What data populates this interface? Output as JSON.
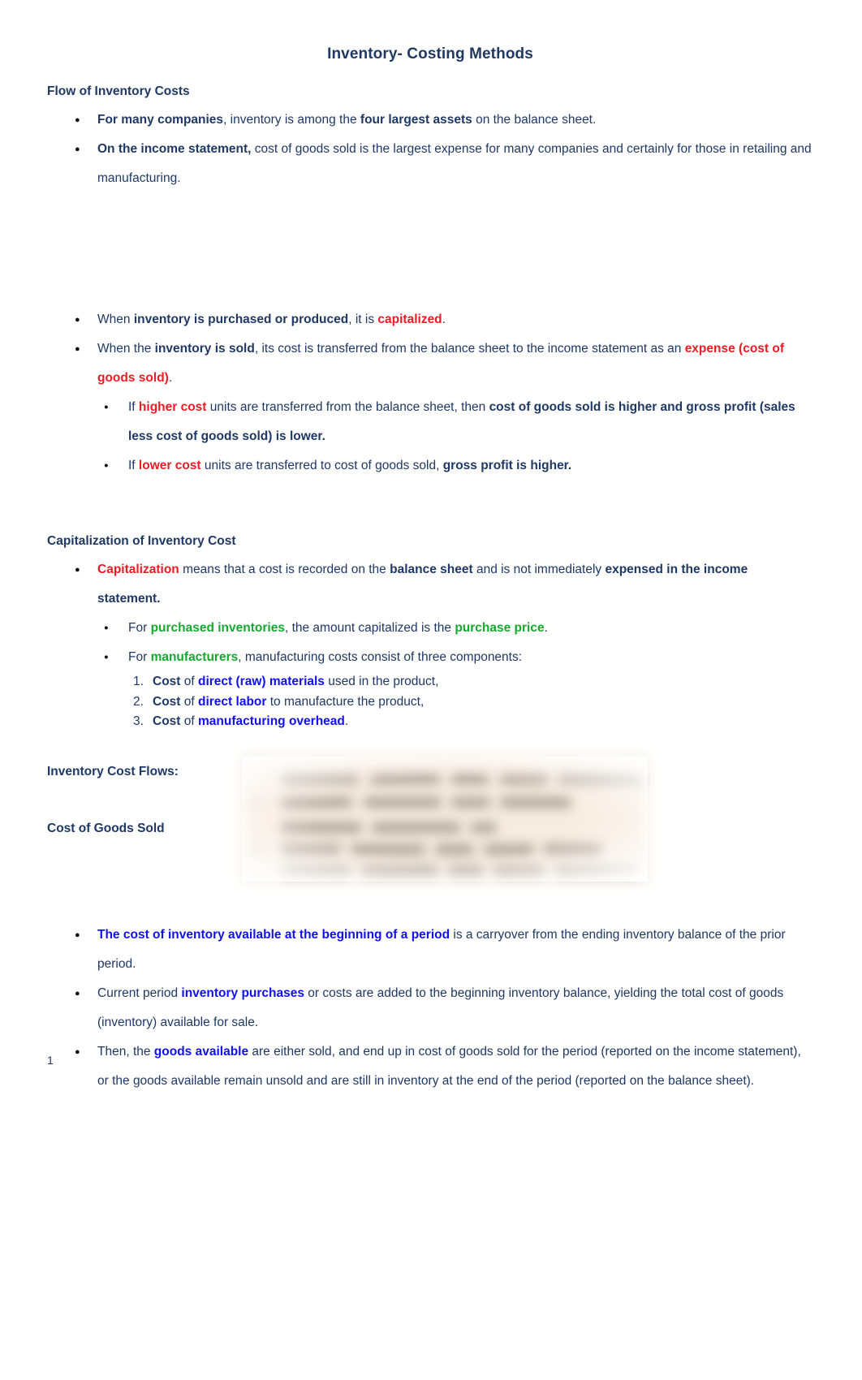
{
  "document": {
    "title": "Inventory- Costing Methods",
    "page_number": "1"
  },
  "sections": [
    {
      "heading": "Flow of Inventory Costs",
      "bullets": [
        {
          "runs": [
            {
              "t": "For many companies",
              "s": "bold-navy"
            },
            {
              "t": ", inventory is among the ",
              "s": "navy"
            },
            {
              "t": "four largest assets",
              "s": "bold-navy"
            },
            {
              "t": " on the balance sheet.",
              "s": "navy"
            }
          ]
        },
        {
          "runs": [
            {
              "t": "On the income statement,",
              "s": "bold-navy"
            },
            {
              "t": " cost of goods sold is the largest expense for many companies and certainly for those in retailing and manufacturing.",
              "s": "navy"
            }
          ]
        }
      ]
    }
  ],
  "flow_bullets": [
    {
      "runs": [
        {
          "t": "When ",
          "s": "navy"
        },
        {
          "t": "inventory is purchased or produced",
          "s": "bold-navy"
        },
        {
          "t": ", it is ",
          "s": "navy"
        },
        {
          "t": "capitalized",
          "s": "red"
        },
        {
          "t": ".",
          "s": "navy"
        }
      ]
    },
    {
      "runs": [
        {
          "t": "When the ",
          "s": "navy"
        },
        {
          "t": "inventory is sold",
          "s": "bold-navy"
        },
        {
          "t": ", its cost is transferred from the balance sheet to the income statement as an ",
          "s": "navy"
        },
        {
          "t": "expense (cost of goods sold)",
          "s": "red"
        },
        {
          "t": ".",
          "s": "navy"
        }
      ],
      "sub": [
        {
          "runs": [
            {
              "t": "If ",
              "s": "navy"
            },
            {
              "t": "higher cost",
              "s": "red"
            },
            {
              "t": " units are transferred from the balance sheet, then ",
              "s": "navy"
            },
            {
              "t": "cost of goods sold is higher and gross profit (sales less cost of goods sold) is lower.",
              "s": "bold-navy"
            }
          ]
        },
        {
          "runs": [
            {
              "t": "If ",
              "s": "navy"
            },
            {
              "t": "lower cost",
              "s": "red"
            },
            {
              "t": " units are transferred to cost of goods sold, ",
              "s": "navy"
            },
            {
              "t": "gross profit is higher.",
              "s": "bold-navy"
            }
          ]
        }
      ]
    }
  ],
  "capitalization": {
    "heading": "Capitalization of Inventory Cost",
    "bullet": {
      "runs": [
        {
          "t": "Capitalization",
          "s": "red"
        },
        {
          "t": " means that a cost is recorded on the ",
          "s": "navy"
        },
        {
          "t": "balance sheet",
          "s": "bold-navy"
        },
        {
          "t": " and is not immediately ",
          "s": "navy"
        },
        {
          "t": "expensed in the income statement.",
          "s": "bold-navy"
        }
      ]
    },
    "sub_bullets": [
      {
        "runs": [
          {
            "t": "For ",
            "s": "navy"
          },
          {
            "t": "purchased inventories",
            "s": "green"
          },
          {
            "t": ", the amount capitalized is the ",
            "s": "navy"
          },
          {
            "t": "purchase price",
            "s": "green"
          },
          {
            "t": ".",
            "s": "navy"
          }
        ]
      },
      {
        "runs": [
          {
            "t": "For ",
            "s": "navy"
          },
          {
            "t": "manufacturers",
            "s": "green"
          },
          {
            "t": ", manufacturing costs consist of three components:",
            "s": "navy"
          }
        ]
      }
    ],
    "numbered": [
      {
        "runs": [
          {
            "t": "Cost",
            "s": "bold-navy"
          },
          {
            "t": " of ",
            "s": "navy"
          },
          {
            "t": "direct (raw) materials",
            "s": "blue"
          },
          {
            "t": " used in the product,",
            "s": "navy"
          }
        ]
      },
      {
        "runs": [
          {
            "t": "Cost",
            "s": "bold-navy"
          },
          {
            "t": " of ",
            "s": "navy"
          },
          {
            "t": "direct labor",
            "s": "blue"
          },
          {
            "t": " to manufacture the product,",
            "s": "navy"
          }
        ]
      },
      {
        "runs": [
          {
            "t": "Cost",
            "s": "bold-navy"
          },
          {
            "t": " of ",
            "s": "navy"
          },
          {
            "t": "manufacturing overhead",
            "s": "blue"
          },
          {
            "t": ".",
            "s": "navy"
          }
        ]
      }
    ]
  },
  "cost_flows": {
    "label": "Inventory Cost Flows:",
    "cogs_label": "Cost of Goods Sold",
    "figure_alt": "blurred inventory cost flow table",
    "figure_background": "#f7ece0"
  },
  "closing_bullets": [
    {
      "runs": [
        {
          "t": "The cost of inventory available at the beginning of a period",
          "s": "blue"
        },
        {
          "t": " is a carryover from the ending inventory balance of the prior period.",
          "s": "navy"
        }
      ]
    },
    {
      "runs": [
        {
          "t": "Current period ",
          "s": "navy"
        },
        {
          "t": "inventory purchases",
          "s": "blue"
        },
        {
          "t": " or costs are added to the beginning inventory balance, yielding the total cost of goods (inventory) available for sale.",
          "s": "navy"
        }
      ]
    },
    {
      "runs": [
        {
          "t": "Then, the ",
          "s": "navy"
        },
        {
          "t": "goods available",
          "s": "blue"
        },
        {
          "t": " are either sold, and end up in cost of goods sold for the period (reported on the income statement), or the goods available remain unsold and are still in inventory at the end of the period (reported on the balance sheet).",
          "s": "navy"
        }
      ]
    }
  ],
  "colors": {
    "navy": "#1f3864",
    "red": "#ee1b24",
    "green": "#17a830",
    "blue": "#1010f0"
  }
}
